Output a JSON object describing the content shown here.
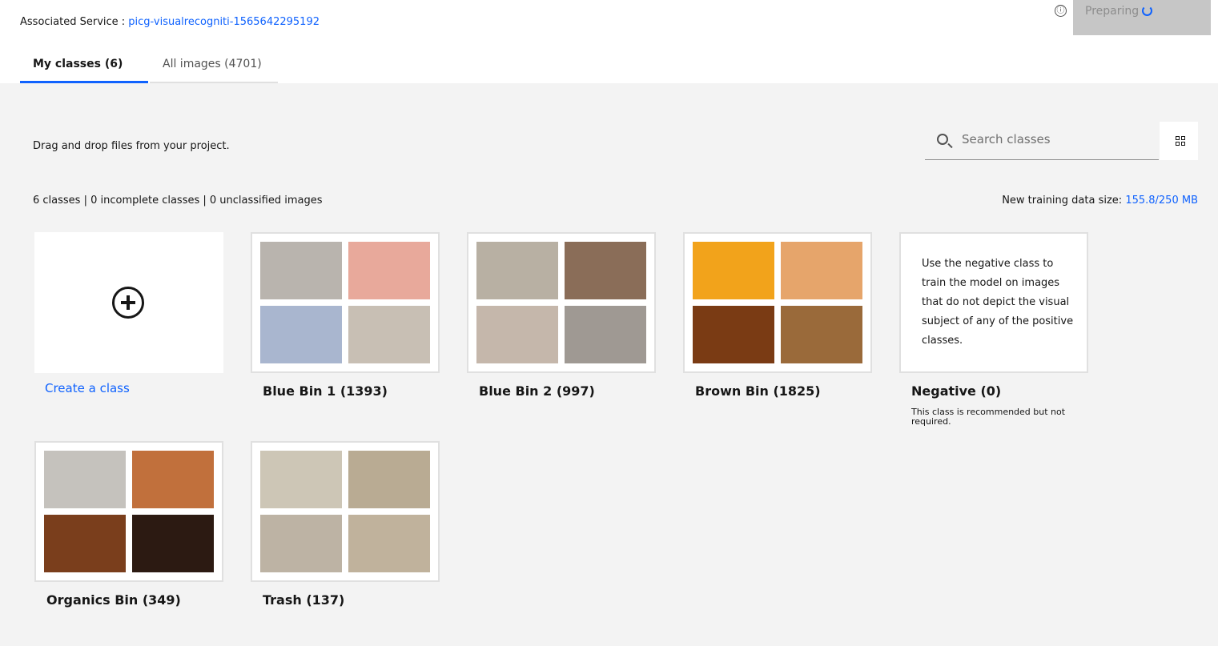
{
  "header": {
    "service_label": "Associated Service :",
    "service_name": "picg-visualrecogniti-1565642295192",
    "info_icon": "ⓘ",
    "status": "Preparing"
  },
  "tabs": [
    {
      "label": "My classes (6)",
      "active": true
    },
    {
      "label": "All images (4701)",
      "active": false
    }
  ],
  "toolbar": {
    "hint": "Drag and drop files from your project.",
    "search_placeholder": "Search classes"
  },
  "summary": {
    "counts": "6 classes | 0 incomplete classes | 0 unclassified images",
    "training_label": "New training data size:",
    "training_value": "155.8/250 MB"
  },
  "create": {
    "label": "Create a class"
  },
  "classes": [
    {
      "title": "Blue Bin 1 (1393)",
      "thumbs": [
        "#b9b4ae",
        "#e8a99b",
        "#a9b6cf",
        "#c8bfb4"
      ]
    },
    {
      "title": "Blue Bin 2 (997)",
      "thumbs": [
        "#b8b0a3",
        "#8a6d58",
        "#c5b7ab",
        "#9f9993"
      ]
    },
    {
      "title": "Brown Bin (1825)",
      "thumbs": [
        "#f2a31b",
        "#e6a56b",
        "#7a3b14",
        "#9a6a3a"
      ]
    },
    {
      "title": "Organics Bin (349)",
      "thumbs": [
        "#c5c2bd",
        "#c1703c",
        "#7a3e1c",
        "#2c1a12"
      ]
    },
    {
      "title": "Trash (137)",
      "thumbs": [
        "#cdc6b6",
        "#b9ab93",
        "#bdb3a4",
        "#c0b29c"
      ]
    }
  ],
  "negative": {
    "title": "Negative (0)",
    "description": "Use the negative class to train the model on images that do not depict the visual subject of any of the positive classes.",
    "note": "This class is recommended but not required."
  },
  "colors": {
    "accent": "#0f62fe",
    "background": "#f3f3f3",
    "status_button": "#c6c6c6"
  }
}
